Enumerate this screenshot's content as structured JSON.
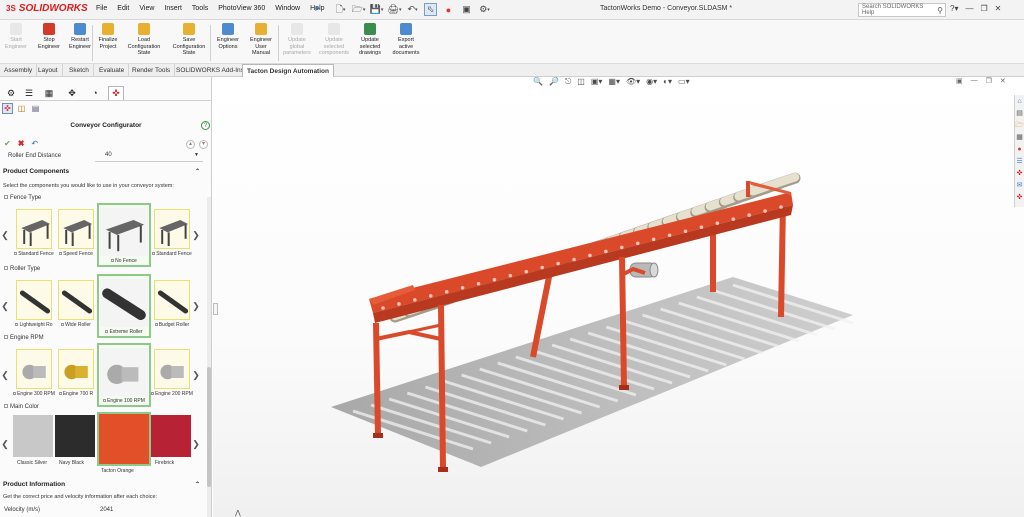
{
  "app": {
    "name": "SOLIDWORKS",
    "logo_prefix": "3S",
    "document_title": "TactonWorks Demo - Conveyor.SLDASM *",
    "brand_color": "#d9201f"
  },
  "menu": [
    "File",
    "Edit",
    "View",
    "Insert",
    "Tools",
    "PhotoView 360",
    "Window",
    "Help"
  ],
  "search": {
    "placeholder": "Search SOLIDWORKS Help"
  },
  "title_icons": [
    "help-icon",
    "minimize-icon",
    "restore-icon",
    "close-icon"
  ],
  "commands": [
    {
      "label": "Start Engineer",
      "enabled": false,
      "icon": "start-engineer-icon",
      "color": "#c9c9c9"
    },
    {
      "label": "Stop Engineer",
      "enabled": true,
      "icon": "stop-engineer-icon",
      "color": "#d23a2a"
    },
    {
      "label": "Restart Engineer",
      "enabled": true,
      "icon": "restart-engineer-icon",
      "color": "#4e8ad0"
    },
    {
      "label": "Finalize Project",
      "enabled": true,
      "icon": "finalize-project-icon",
      "color": "#e8b030"
    },
    {
      "label": "Load Configuration State",
      "enabled": true,
      "icon": "load-configuration-icon",
      "color": "#e8b030"
    },
    {
      "label": "Save Configuration State",
      "enabled": true,
      "icon": "save-configuration-icon",
      "color": "#e8b030"
    },
    {
      "label": "Engineer Options",
      "enabled": true,
      "icon": "engineer-options-icon",
      "color": "#4e8ad0"
    },
    {
      "label": "Engineer User Manual",
      "enabled": true,
      "icon": "user-manual-icon",
      "color": "#e8b030"
    },
    {
      "label": "Update global parameters",
      "enabled": false,
      "icon": "update-global-icon",
      "color": "#c9c9c9"
    },
    {
      "label": "Update selected components",
      "enabled": false,
      "icon": "update-components-icon",
      "color": "#c9c9c9"
    },
    {
      "label": "Update selected drawings",
      "enabled": true,
      "icon": "update-drawings-icon",
      "color": "#3c8c50"
    },
    {
      "label": "Export active documents",
      "enabled": true,
      "icon": "export-documents-icon",
      "color": "#4e8ad0"
    }
  ],
  "tabs": [
    "Assembly",
    "Layout",
    "Sketch",
    "Evaluate",
    "Render Tools",
    "SOLIDWORKS Add-Ins",
    "Tacton Design Automation"
  ],
  "active_tab": "Tacton Design Automation",
  "panel": {
    "title": "Conveyor Configurator",
    "roller_end": {
      "label": "Roller End Distance",
      "value": "40"
    },
    "components_header": "Product Components",
    "components_hint": "Select the components you would like to use in your conveyor system:",
    "groups": [
      {
        "label": "Fence Type",
        "options": [
          "Standard Fence",
          "Speed Fence",
          "No Fence",
          "Standard Fence"
        ],
        "selected": "No Fence"
      },
      {
        "label": "Roller Type",
        "options": [
          "Lightweight Ro",
          "Wide Roller",
          "Extreme Roller",
          "Budget Roller"
        ],
        "selected": "Extreme Roller"
      },
      {
        "label": "Engine RPM",
        "options": [
          "Engine 300 RPM",
          "Engine 700 R",
          "Engine 100 RPM",
          "Engine 200 RPM"
        ],
        "selected": "Engine 100 RPM"
      },
      {
        "label": "Main Color",
        "options": [
          "Classic Silver",
          "Navy Black",
          "Tacton Orange",
          "Firebrick"
        ],
        "selected": "Tacton Orange"
      }
    ],
    "colors": {
      "Classic Silver": "#c8c8c8",
      "Navy Black": "#2c2c2c",
      "Tacton Orange": "#e2502a",
      "Firebrick": "#b72234"
    },
    "info_header": "Product Information",
    "info_hint": "Get the correct price and velocity information after each choice:",
    "velocity": {
      "label": "Velocity (m/s)",
      "value": "2041"
    }
  },
  "model": {
    "frame_color": "#d9492a",
    "roller_color": "#e6e0cf",
    "shadow_color": "#9a9a9a"
  }
}
